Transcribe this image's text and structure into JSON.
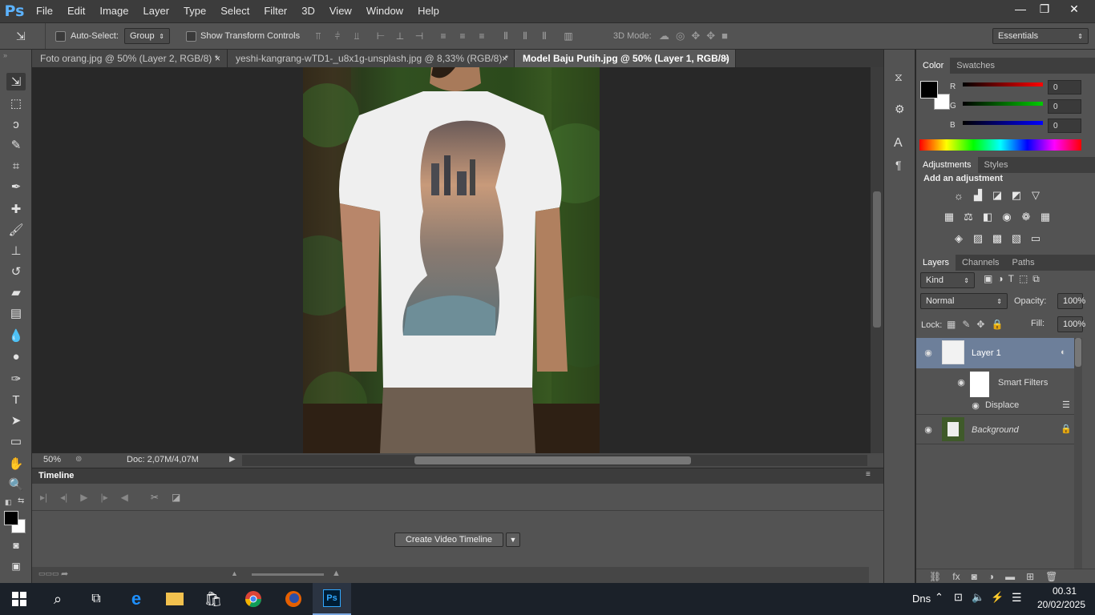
{
  "app": {
    "logo": "Ps"
  },
  "menu": [
    "File",
    "Edit",
    "Image",
    "Layer",
    "Type",
    "Select",
    "Filter",
    "3D",
    "View",
    "Window",
    "Help"
  ],
  "window_controls": {
    "minimize": "—",
    "restore": "❐",
    "close": "✕"
  },
  "options": {
    "auto_select_label": "Auto-Select:",
    "auto_select_value": "Group",
    "transform_label": "Show Transform Controls",
    "mode3d_label": "3D Mode:",
    "workspace": "Essentials"
  },
  "doc_tabs": [
    {
      "label": "Foto orang.jpg @ 50% (Layer 2, RGB/8) *",
      "close": "×"
    },
    {
      "label": "yeshi-kangrang-wTD1-_u8x1g-unsplash.jpg @ 8,33% (RGB/8) *",
      "close": "×"
    },
    {
      "label": "Model Baju Putih.jpg @ 50% (Layer 1, RGB/8) *",
      "close": "×"
    }
  ],
  "status": {
    "zoom": "50%",
    "doc": "Doc: 2,07M/4,07M"
  },
  "timeline": {
    "title": "Timeline",
    "create_button": "Create Video Timeline"
  },
  "color_panel": {
    "tabs": [
      "Color",
      "Swatches"
    ],
    "channels": [
      {
        "name": "R",
        "value": "0"
      },
      {
        "name": "G",
        "value": "0"
      },
      {
        "name": "B",
        "value": "0"
      }
    ],
    "foreground": "#000000",
    "background": "#ffffff"
  },
  "adjustments_panel": {
    "tabs": [
      "Adjustments",
      "Styles"
    ],
    "heading": "Add an adjustment"
  },
  "layers_panel": {
    "tabs": [
      "Layers",
      "Channels",
      "Paths"
    ],
    "kind": "Kind",
    "blend_mode": "Normal",
    "opacity_label": "Opacity:",
    "opacity_value": "100%",
    "lock_label": "Lock:",
    "fill_label": "Fill:",
    "fill_value": "100%",
    "layers": [
      {
        "name": "Layer 1",
        "selected": true
      },
      {
        "name": "Smart Filters"
      },
      {
        "name": "Displace"
      },
      {
        "name": "Background"
      }
    ]
  },
  "taskbar": {
    "lang": "Dns",
    "time": "00.31",
    "date": "20/02/2025"
  }
}
